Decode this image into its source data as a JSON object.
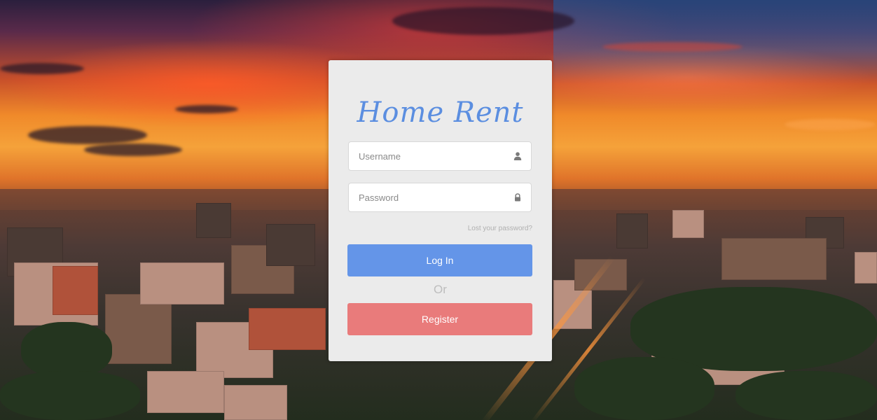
{
  "brand": {
    "title": "Home Rent",
    "color": "#5b8ee0"
  },
  "login_form": {
    "username": {
      "placeholder": "Username",
      "value": "",
      "icon": "user-icon"
    },
    "password": {
      "placeholder": "Password",
      "value": "",
      "icon": "lock-icon"
    },
    "forgot_link": "Lost your password?",
    "login_button": "Log In",
    "separator": "Or",
    "register_button": "Register"
  },
  "colors": {
    "login_button": "#6495e8",
    "register_button": "#e97b7b",
    "panel_background": "#ebebeb"
  },
  "background": {
    "description_icon": "city-sunset-background"
  }
}
